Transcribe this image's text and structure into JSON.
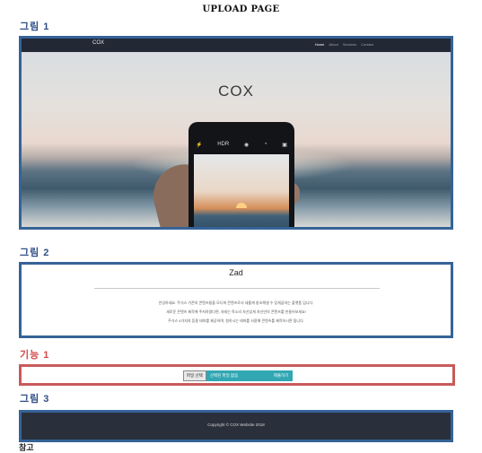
{
  "page": {
    "title": "UPLOAD PAGE"
  },
  "labels": {
    "fig1": "그림 1",
    "fig2": "그림 2",
    "func1": "기능 1",
    "fig3": "그림 3",
    "bottom": "참고"
  },
  "fig1": {
    "navbar": {
      "brand": "COX",
      "items": [
        "Home",
        "About",
        "Services",
        "Contact"
      ],
      "active_item": "Home"
    },
    "hero": {
      "title": "COX",
      "phone_icons": [
        "flash-off-icon",
        "HDR",
        "camera-mode-icon",
        "timer-icon",
        "camera-icon"
      ],
      "phone_hdr_text": "HDR"
    }
  },
  "fig2": {
    "title": "Zad",
    "lines": [
      "안녕하세요. 주식스 기존의 콘텐츠들을 모디파 콘텐츠로서 새롭게 창조해낼 수 있게끔하는 플랫폼 입니다.",
      "새로운 콘텐츠 제작에 주저하였다면, 자레는 목소리 자신있게 자신만의 콘텐츠를 만들어보세요!",
      "주식스 4가지의 등용 테마를 제공하며, 원하시는 테마를 사용해 콘텐츠를 제작하시면 됩니다."
    ]
  },
  "func1": {
    "choose_label": "파일 선택",
    "file_status": "선택된 파일 없음",
    "submit_label": "제출하기"
  },
  "fig3": {
    "footer": "Copyright © COX Website 2018"
  },
  "colors": {
    "frame_blue": "#356398",
    "frame_red": "#c85a5a",
    "accent_teal": "#31a7b3",
    "navbar": "#222834",
    "footer": "#2a303b"
  }
}
